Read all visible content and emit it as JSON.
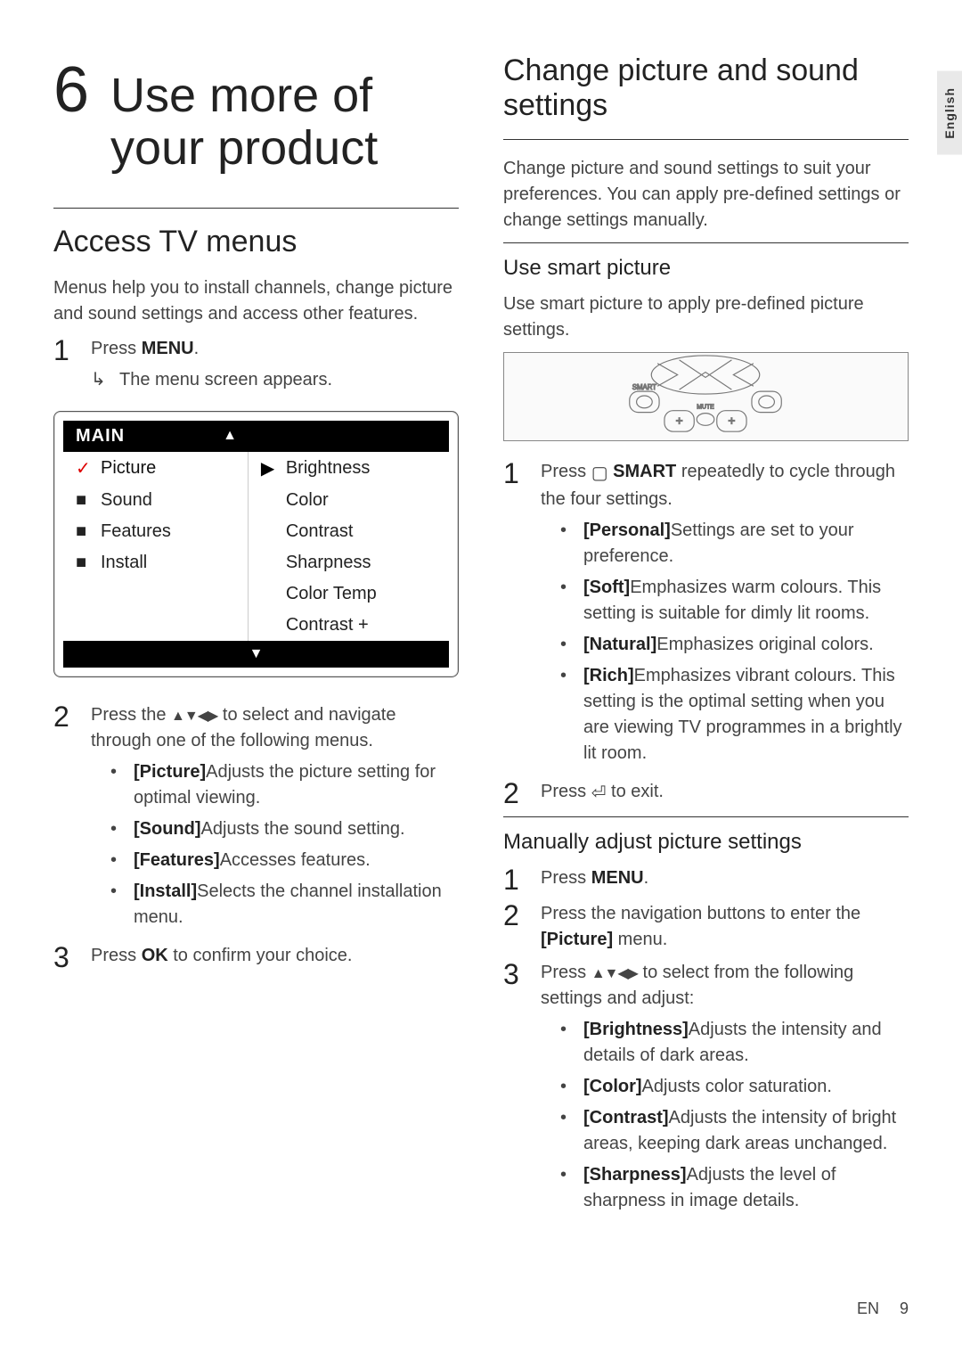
{
  "language_tab": "English",
  "chapter": {
    "number": "6",
    "title_line1": "Use more of",
    "title_line2": "your product"
  },
  "left": {
    "h2": "Access TV menus",
    "intro": "Menus help you to install channels, change picture and sound settings and access other features.",
    "step1": {
      "pre": "Press ",
      "key": "MENU",
      "post": "."
    },
    "step1_sub": "The menu screen appears.",
    "osd": {
      "header": "MAIN",
      "left_items": [
        {
          "mark": "✓",
          "label": "Picture",
          "selected": true
        },
        {
          "mark": "■",
          "label": "Sound"
        },
        {
          "mark": "■",
          "label": "Features"
        },
        {
          "mark": "■",
          "label": "Install"
        }
      ],
      "right_items": [
        {
          "mark": "▶",
          "label": "Brightness"
        },
        {
          "mark": "",
          "label": "Color"
        },
        {
          "mark": "",
          "label": "Contrast"
        },
        {
          "mark": "",
          "label": "Sharpness"
        },
        {
          "mark": "",
          "label": "Color Temp"
        },
        {
          "mark": "",
          "label": "Contrast +"
        }
      ]
    },
    "step2": {
      "pre": "Press the ",
      "arrows": "▲▼◀▶",
      "post": " to select and navigate through one of the following menus."
    },
    "step2_bullets": [
      {
        "b": "[Picture]",
        "t": "Adjusts the picture setting for optimal viewing."
      },
      {
        "b": "[Sound]",
        "t": "Adjusts the sound setting."
      },
      {
        "b": "[Features]",
        "t": "Accesses features."
      },
      {
        "b": "[Install]",
        "t": "Selects the channel installation menu."
      }
    ],
    "step3": {
      "pre": "Press ",
      "key": "OK",
      "post": " to confirm your choice."
    }
  },
  "right": {
    "h2": "Change picture and sound settings",
    "intro": "Change picture and sound settings to suit your preferences. You can apply pre-defined settings or change settings manually.",
    "sec1": {
      "h3": "Use smart picture",
      "intro": "Use smart picture to apply pre-defined picture settings.",
      "step1": {
        "pre": "Press ",
        "icon": "▢",
        "key": "SMART",
        "post": " repeatedly to cycle through the four settings."
      },
      "bullets": [
        {
          "b": "[Personal]",
          "t": "Settings are set to your preference."
        },
        {
          "b": "[Soft]",
          "t": "Emphasizes warm colours. This setting is suitable for dimly lit rooms."
        },
        {
          "b": "[Natural]",
          "t": "Emphasizes original colors."
        },
        {
          "b": "[Rich]",
          "t": "Emphasizes vibrant colours. This setting is the optimal setting when you are viewing TV programmes in a brightly lit room."
        }
      ],
      "step2": {
        "pre": "Press ",
        "icon": "⏎",
        "post": " to exit."
      }
    },
    "sec2": {
      "h3": "Manually adjust picture settings",
      "step1": {
        "pre": "Press ",
        "key": "MENU",
        "post": "."
      },
      "step2": {
        "pre": "Press the navigation buttons to enter the ",
        "key": "[Picture]",
        "post": " menu."
      },
      "step3": {
        "pre": "Press ",
        "arrows": "▲▼◀▶",
        "post": " to select from the following settings and adjust:"
      },
      "bullets": [
        {
          "b": "[Brightness]",
          "t": "Adjusts the intensity and details of dark areas."
        },
        {
          "b": "[Color]",
          "t": "Adjusts color saturation."
        },
        {
          "b": "[Contrast]",
          "t": "Adjusts the intensity of bright areas, keeping dark areas unchanged."
        },
        {
          "b": "[Sharpness]",
          "t": "Adjusts the level of sharpness in image details."
        }
      ]
    }
  },
  "footer": {
    "lang": "EN",
    "page": "9"
  }
}
